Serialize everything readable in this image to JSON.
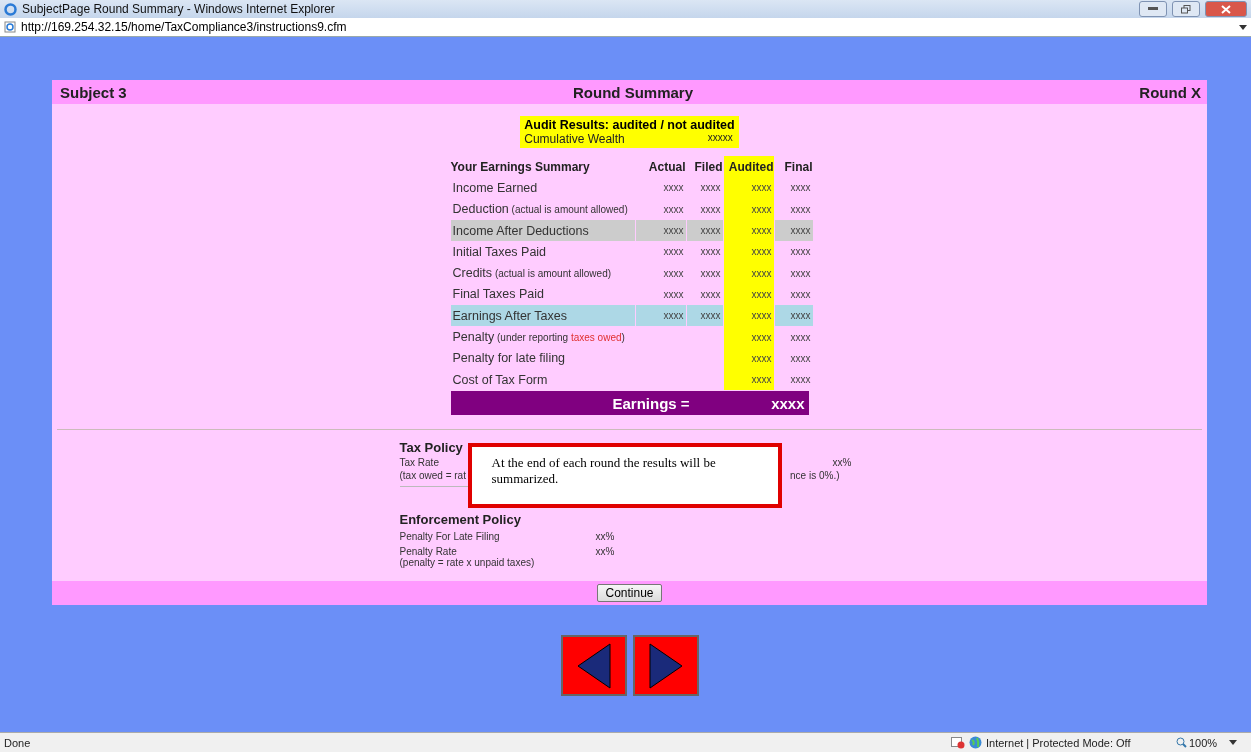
{
  "window": {
    "title": "SubjectPage Round Summary - Windows Internet Explorer",
    "address": "http://169.254.32.15/home/TaxCompliance3/instructions9.cfm"
  },
  "header": {
    "subject": "Subject 3",
    "title": "Round Summary",
    "round": "Round X"
  },
  "audit": {
    "title": "Audit Results: audited / not audited",
    "wealth_label": "Cumulative Wealth",
    "wealth_value": "xxxxx"
  },
  "table": {
    "label_header": "Your Earnings Summary",
    "columns": [
      "Actual",
      "Filed",
      "Audited",
      "Final"
    ],
    "rows": [
      {
        "kind": "normal",
        "label": "Income Earned",
        "cells": [
          "xxxx",
          "xxxx",
          "xxxx",
          "xxxx"
        ]
      },
      {
        "kind": "normal",
        "label": "Deduction",
        "note": "(actual is amount allowed)",
        "cells": [
          "xxxx",
          "xxxx",
          "xxxx",
          "xxxx"
        ]
      },
      {
        "kind": "gray",
        "label": "Income After Deductions",
        "cells": [
          "xxxx",
          "xxxx",
          "xxxx",
          "xxxx"
        ]
      },
      {
        "kind": "normal",
        "label": "Initial Taxes Paid",
        "cells": [
          "xxxx",
          "xxxx",
          "xxxx",
          "xxxx"
        ]
      },
      {
        "kind": "normal",
        "label": "Credits",
        "note": "(actual is amount allowed)",
        "cells": [
          "xxxx",
          "xxxx",
          "xxxx",
          "xxxx"
        ]
      },
      {
        "kind": "normal",
        "label": "Final Taxes Paid",
        "cells": [
          "xxxx",
          "xxxx",
          "xxxx",
          "xxxx"
        ]
      },
      {
        "kind": "blue",
        "label": "Earnings After Taxes",
        "cells": [
          "xxxx",
          "xxxx",
          "xxxx",
          "xxxx"
        ]
      },
      {
        "kind": "normal",
        "label": "Penalty",
        "note": "(under reporting",
        "note_alert": "taxes owed",
        "note_end": ")",
        "cells": [
          "",
          "",
          "xxxx",
          "xxxx"
        ]
      },
      {
        "kind": "normal",
        "label": "Penalty for late filing",
        "cells": [
          "",
          "",
          "xxxx",
          "xxxx"
        ]
      },
      {
        "kind": "normal",
        "label": "Cost of Tax Form",
        "cells": [
          "",
          "",
          "xxxx",
          "xxxx"
        ]
      }
    ],
    "total_label": "Earnings =",
    "total_value": "xxxx"
  },
  "tax_policy": {
    "title": "Tax Policy",
    "rate_label": "Tax Rate",
    "rate_value": "xx%",
    "formula_start": "(tax owed = rat",
    "formula_end": "nce is 0%.)"
  },
  "enforcement_policy": {
    "title": "Enforcement Policy",
    "rows": [
      {
        "label": "Penalty For Late Filing",
        "value": "xx%"
      },
      {
        "label": "Penalty Rate",
        "value": "xx%",
        "note": "(penalty = rate x unpaid taxes)"
      }
    ]
  },
  "callout": {
    "text": "At the end of each round the results will be summarized."
  },
  "continue_button": "Continue",
  "status_bar": {
    "left": "Done",
    "zone": "Internet | Protected Mode: Off",
    "zoom": "100%"
  }
}
